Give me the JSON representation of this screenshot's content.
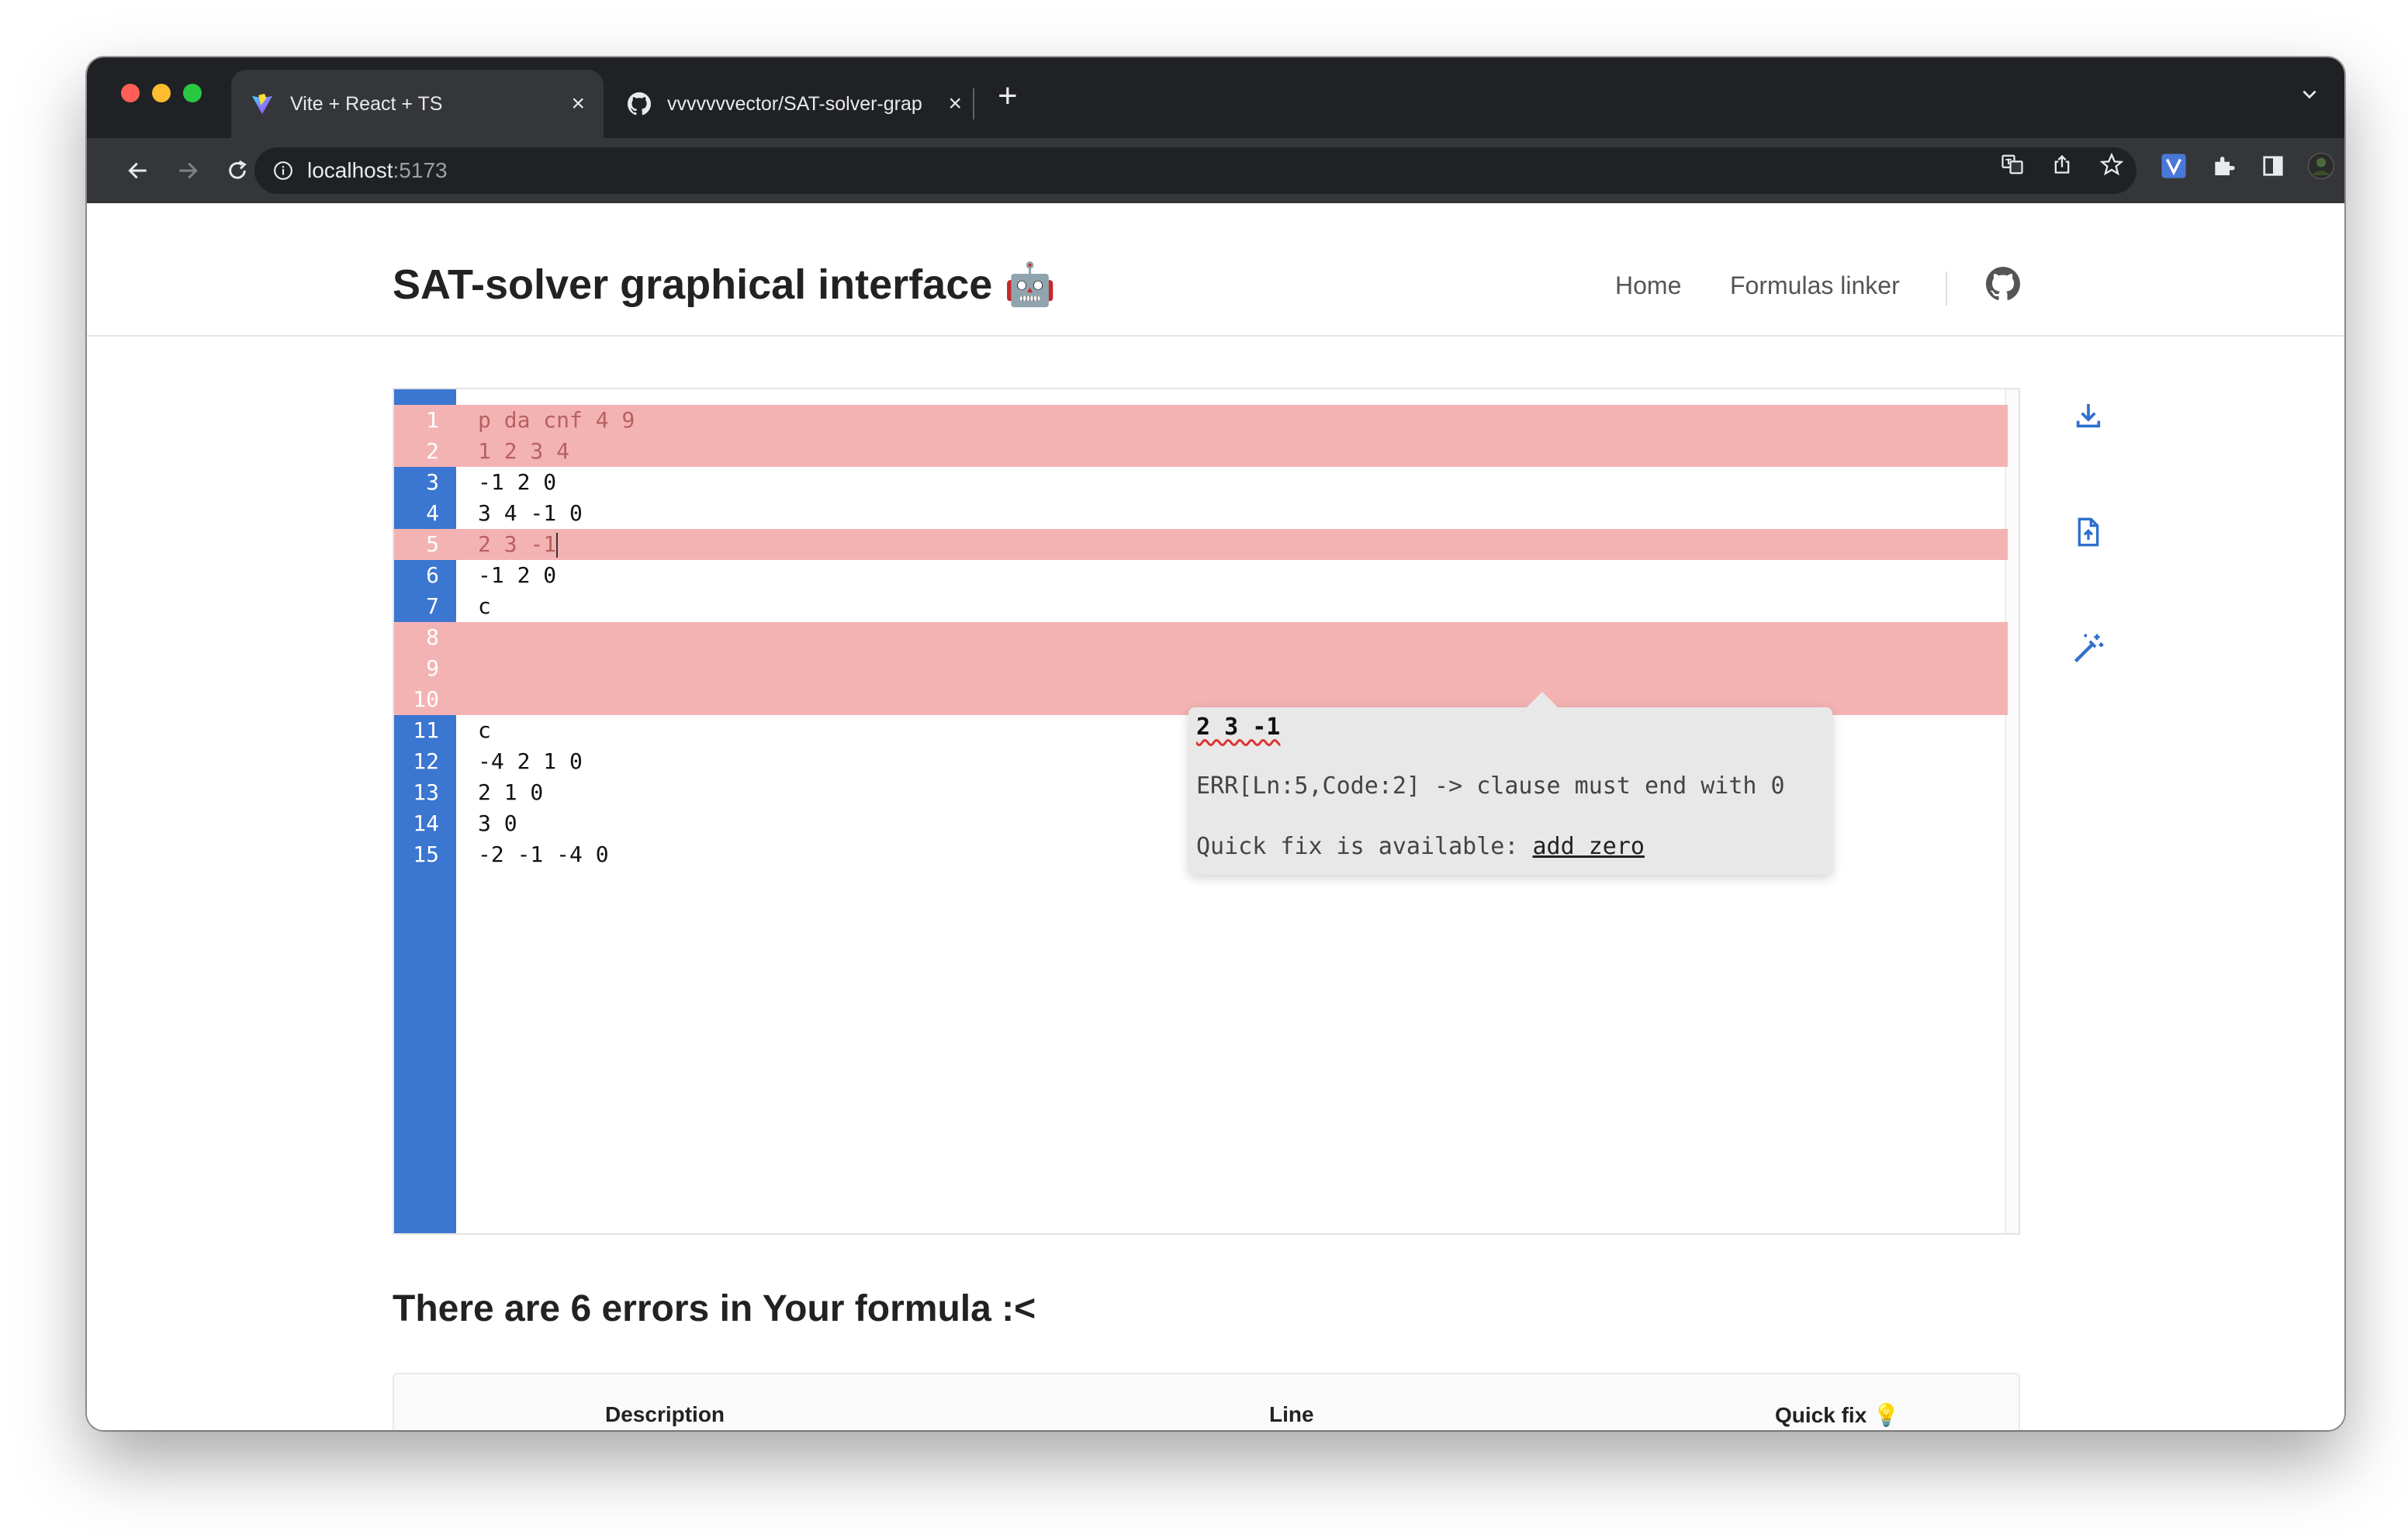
{
  "browser": {
    "tabs": [
      {
        "title": "Vite + React + TS",
        "active": true,
        "icon": "vite-icon"
      },
      {
        "title": "vvvvvvvector/SAT-solver-grap",
        "active": false,
        "icon": "github-icon"
      }
    ],
    "url": {
      "host": "localhost",
      "port": ":5173"
    }
  },
  "header": {
    "title": "SAT-solver graphical interface 🤖",
    "nav": [
      {
        "label": "Home"
      },
      {
        "label": "Formulas linker"
      }
    ]
  },
  "editor": {
    "lines": [
      {
        "num": "1",
        "text": "p da cnf 4 9",
        "error": true
      },
      {
        "num": "2",
        "text": "1 2 3 4",
        "error": true
      },
      {
        "num": "3",
        "text": "-1 2 0",
        "error": false
      },
      {
        "num": "4",
        "text": "3 4 -1 0",
        "error": false
      },
      {
        "num": "5",
        "text": "2 3 -1",
        "error": true
      },
      {
        "num": "6",
        "text": "-1 2 0",
        "error": false
      },
      {
        "num": "7",
        "text": "c",
        "error": false
      },
      {
        "num": "8",
        "text": "",
        "error": true
      },
      {
        "num": "9",
        "text": "",
        "error": true
      },
      {
        "num": "10",
        "text": "",
        "error": true
      },
      {
        "num": "11",
        "text": "c",
        "error": false
      },
      {
        "num": "12",
        "text": "-4 2 1 0",
        "error": false
      },
      {
        "num": "13",
        "text": "2 1 0",
        "error": false
      },
      {
        "num": "14",
        "text": "3 0",
        "error": false
      },
      {
        "num": "15",
        "text": "-2 -1 -4 0",
        "error": false
      }
    ],
    "tooltip": {
      "code": "2 3 -1",
      "message": "ERR[Ln:5,Code:2] -> clause must end with 0",
      "fix_prefix": "Quick fix is available: ",
      "fix_link": "add zero"
    }
  },
  "errors": {
    "heading": "There are 6 errors in Your formula :<",
    "columns": [
      "Description",
      "Line",
      "Quick fix 💡"
    ]
  },
  "colors": {
    "gutter": "#3b76d0",
    "error_line": "#f4b3b3",
    "accent": "#2f6fcf"
  }
}
